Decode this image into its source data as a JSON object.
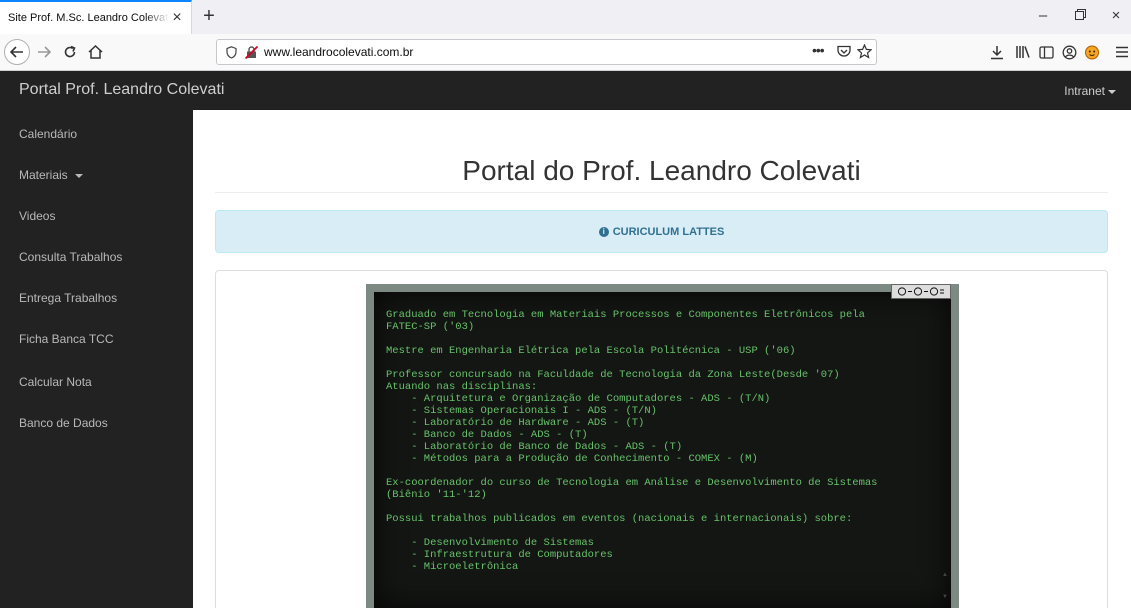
{
  "browser": {
    "tab_title": "Site Prof. M.Sc. Leandro Colevati de",
    "url_host": "www.leandrocolevati.com.br"
  },
  "site": {
    "brand": "Portal Prof. Leandro Colevati",
    "intranet_label": "Intranet"
  },
  "sidebar": {
    "items": [
      {
        "label": "Calendário"
      },
      {
        "label": "Materiais",
        "dropdown": true
      },
      {
        "label": "Videos"
      },
      {
        "label": "Consulta Trabalhos"
      },
      {
        "label": "Entrega Trabalhos"
      },
      {
        "label": "Ficha Banca TCC"
      },
      {
        "label": "Calcular Nota"
      },
      {
        "label": "Banco de Dados"
      }
    ]
  },
  "main": {
    "page_title": "Portal do Prof. Leandro Colevati",
    "alert_label": "CURICULUM LATTES",
    "terminal_lines": [
      "Graduado em Tecnologia em Materiais Processos e Componentes Eletrônicos pela",
      "FATEC-SP ('03)",
      "",
      "Mestre em Engenharia Elétrica pela Escola Politécnica - USP ('06)",
      "",
      "Professor concursado na Faculdade de Tecnologia da Zona Leste(Desde '07)",
      "Atuando nas disciplinas:",
      "    - Arquitetura e Organização de Computadores - ADS - (T/N)",
      "    - Sistemas Operacionais I - ADS - (T/N)",
      "    - Laboratório de Hardware - ADS - (T)",
      "    - Banco de Dados - ADS - (T)",
      "    - Laboratório de Banco de Dados - ADS - (T)",
      "    - Métodos para a Produção de Conhecimento - COMEX - (M)",
      "",
      "Ex-coordenador do curso de Tecnologia em Análise e Desenvolvimento de Sistemas",
      "(Biênio '11-'12)",
      "",
      "Possui trabalhos publicados em eventos (nacionais e internacionais) sobre:",
      "",
      "    - Desenvolvimento de Sistemas",
      "    - Infraestrutura de Computadores",
      "    - Microeletrônica"
    ]
  }
}
